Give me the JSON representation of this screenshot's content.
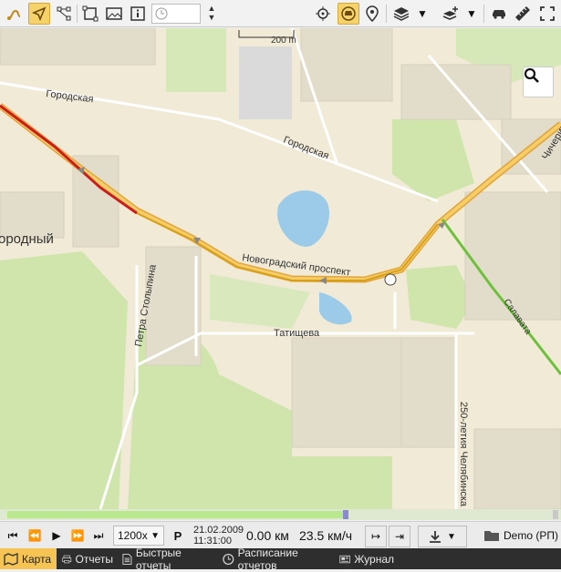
{
  "toolbar": {
    "left_icons": [
      "route-icon",
      "navigate-icon",
      "branch-icon",
      "select-area-icon",
      "picture-icon",
      "info-icon"
    ],
    "time_value": "",
    "right_icons": [
      "target-icon",
      "car-marker-icon",
      "pin-icon",
      "layers-icon",
      "add-layer-icon",
      "vehicle-icon",
      "ruler-icon",
      "fullscreen-icon"
    ]
  },
  "map": {
    "scale_label": "200 m",
    "labels": {
      "gorodskaya1": "Городская",
      "gorodskaya2": "Городская",
      "district": "ородный",
      "novogradsky": "Новоградский проспект",
      "stolypina": "Петра Столыпина",
      "tatishcheva": "Татищева",
      "chelyabinsk": "250-летия Челябинска",
      "edge_right": "Чичерина",
      "bottom_right": "Салавата"
    }
  },
  "player": {
    "speed_option": "1200x",
    "parking_label": "P",
    "date": "21.02.2009",
    "time": "11:31:00",
    "distance": "0.00 км",
    "velocity": "23.5 км/ч",
    "account": "Demo (РП)"
  },
  "track": {
    "progress": 0.62
  },
  "tabs": [
    {
      "label": "Карта",
      "icon": "map-icon",
      "active": true
    },
    {
      "label": "Отчеты",
      "icon": "printer-icon",
      "active": false
    },
    {
      "label": "Быстрые отчеты",
      "icon": "document-icon",
      "active": false
    },
    {
      "label": "Расписание отчетов",
      "icon": "clock-icon",
      "active": false
    },
    {
      "label": "Журнал",
      "icon": "journal-icon",
      "active": false
    }
  ]
}
